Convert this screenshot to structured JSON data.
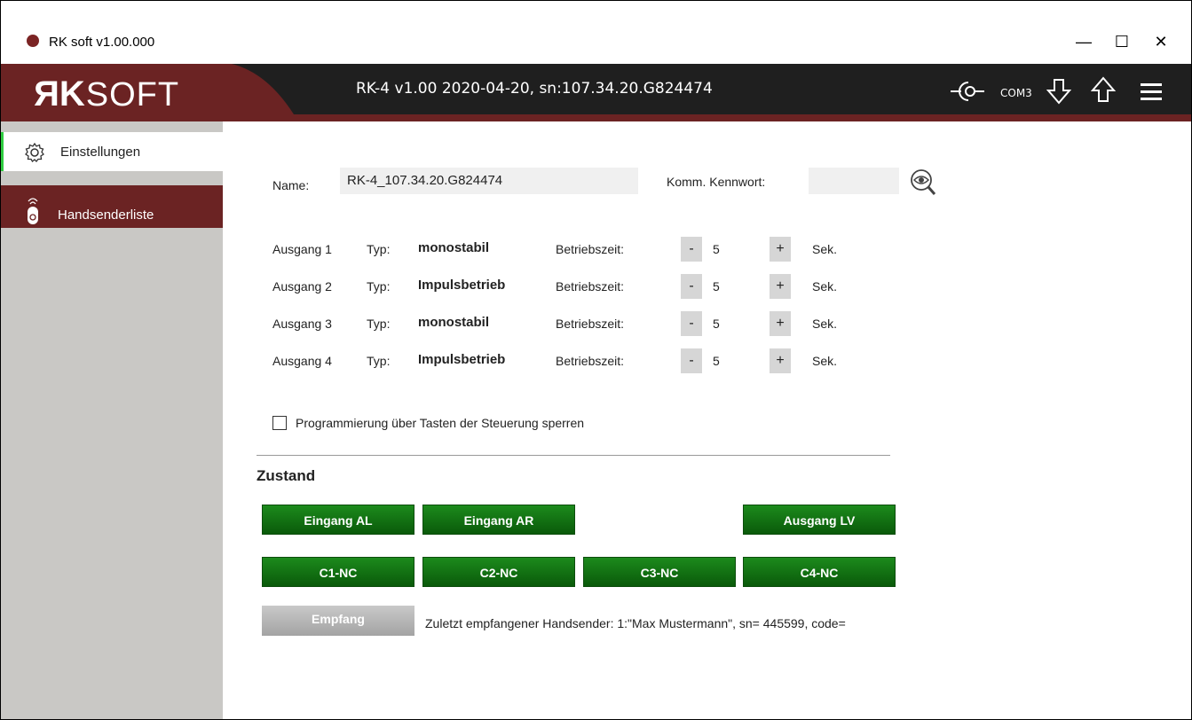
{
  "window": {
    "title": "RK soft v1.00.000",
    "minimize": "—",
    "maximize": "☐",
    "close": "✕"
  },
  "header": {
    "brand_r": "R",
    "brand_k": "K",
    "brand_soft": "SOFT",
    "device_info": "RK-4 v1.00 2020-04-20,  sn:107.34.20.G824474",
    "com_port": "COM3",
    "colors": {
      "header_bg": "#1f1f1f",
      "accent": "#6b2323"
    }
  },
  "sidebar": {
    "items": [
      {
        "label": "Einstellungen",
        "icon": "gear-icon"
      },
      {
        "label": "Handsenderliste",
        "icon": "remote-icon"
      }
    ]
  },
  "settings": {
    "name_label": "Name:",
    "name_value": "RK-4_107.34.20.G824474",
    "password_label": "Komm. Kennwort:",
    "password_value": "",
    "outputs": [
      {
        "label": "Ausgang 1",
        "typ_label": "Typ:",
        "typ": "monostabil",
        "time_label": "Betriebszeit:",
        "minus": "-",
        "value": "5",
        "plus": "+",
        "unit": "Sek."
      },
      {
        "label": "Ausgang 2",
        "typ_label": "Typ:",
        "typ": "Impulsbetrieb",
        "time_label": "Betriebszeit:",
        "minus": "-",
        "value": "5",
        "plus": "+",
        "unit": "Sek."
      },
      {
        "label": "Ausgang 3",
        "typ_label": "Typ:",
        "typ": "monostabil",
        "time_label": "Betriebszeit:",
        "minus": "-",
        "value": "5",
        "plus": "+",
        "unit": "Sek."
      },
      {
        "label": "Ausgang 4",
        "typ_label": "Typ:",
        "typ": "Impulsbetrieb",
        "time_label": "Betriebszeit:",
        "minus": "-",
        "value": "5",
        "plus": "+",
        "unit": "Sek."
      }
    ],
    "lock_label": "Programmierung über Tasten der Steuerung sperren",
    "lock_checked": false
  },
  "status": {
    "heading": "Zustand",
    "row1": [
      "Eingang AL",
      "Eingang AR",
      "Ausgang LV"
    ],
    "row2": [
      "C1-NC",
      "C2-NC",
      "C3-NC",
      "C4-NC"
    ],
    "receive_button": "Empfang",
    "last_received": "Zuletzt empfangener Handsender:   1:\"Max Mustermann\", sn= 445599, code=",
    "colors": {
      "active_green": "#0f6e0f",
      "inactive_gray": "#b5b5b5"
    }
  }
}
